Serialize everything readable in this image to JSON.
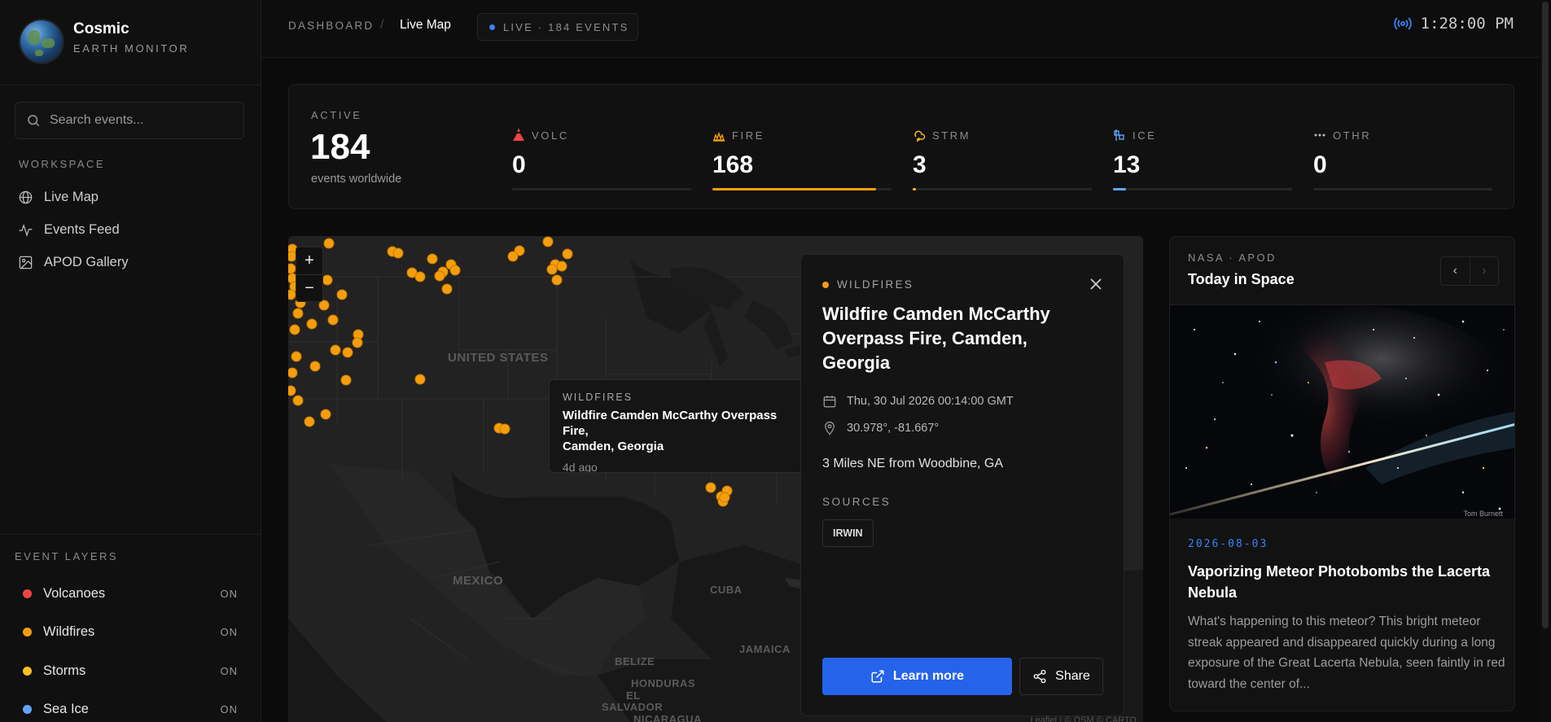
{
  "brand": {
    "name": "Cosmic",
    "subtitle": "EARTH MONITOR"
  },
  "search": {
    "placeholder": "Search events..."
  },
  "workspace": {
    "label": "WORKSPACE",
    "items": [
      {
        "label": "Live Map",
        "icon": "globe-icon"
      },
      {
        "label": "Events Feed",
        "icon": "activity-icon"
      },
      {
        "label": "APOD Gallery",
        "icon": "image-icon"
      }
    ]
  },
  "layers": {
    "label": "EVENT LAYERS",
    "items": [
      {
        "label": "Volcanoes",
        "status": "ON",
        "color": "#ef4444"
      },
      {
        "label": "Wildfires",
        "status": "ON",
        "color": "#f59e0b"
      },
      {
        "label": "Storms",
        "status": "ON",
        "color": "#fbbf24"
      },
      {
        "label": "Sea Ice",
        "status": "ON",
        "color": "#60a5fa"
      }
    ]
  },
  "header": {
    "breadcrumb_root": "DASHBOARD",
    "breadcrumb_current": "Live Map",
    "live_label": "LIVE · 184 EVENTS",
    "time": "1:28:00 PM"
  },
  "stats": {
    "active_label": "ACTIVE",
    "active_count": "184",
    "active_sub": "events worldwide",
    "items": [
      {
        "label": "VOLC",
        "value": "0",
        "fraction": 0,
        "color": "#ef4444",
        "icon": "volcano-icon"
      },
      {
        "label": "FIRE",
        "value": "168",
        "fraction": 0.913,
        "color": "#f59e0b",
        "icon": "fire-icon"
      },
      {
        "label": "STRM",
        "value": "3",
        "fraction": 0.016,
        "color": "#fbbf24",
        "icon": "storm-icon"
      },
      {
        "label": "ICE",
        "value": "13",
        "fraction": 0.071,
        "color": "#60a5fa",
        "icon": "ice-icon"
      },
      {
        "label": "OTHR",
        "value": "0",
        "fraction": 0,
        "color": "#9ca3af",
        "icon": "more-icon"
      }
    ]
  },
  "map": {
    "zoom_in": "+",
    "zoom_out": "−",
    "labels": {
      "usa": "UNITED STATES",
      "mexico": "MEXICO",
      "cuba": "CUBA",
      "jamaica": "JAMAICA",
      "belize": "BELIZE",
      "honduras": "HONDURAS",
      "el": "EL",
      "salvador": "SALVADOR",
      "nicaragua": "NICARAGUA"
    },
    "tooltip": {
      "category": "WILDFIRES",
      "title": "Wildfire Camden McCarthy Overpass Fire,\nCamden, Georgia",
      "age": "4d ago"
    },
    "attribution": "Leaflet | © OSM © CARTO"
  },
  "detail": {
    "category": "WILDFIRES",
    "title": "Wildfire Camden McCarthy Overpass Fire, Camden, Georgia",
    "date": "Thu, 30 Jul 2026 00:14:00 GMT",
    "coords": "30.978°, -81.667°",
    "location": "3 Miles NE from Woodbine, GA",
    "sources_label": "SOURCES",
    "source": "IRWIN",
    "learn_more": "Learn more",
    "share": "Share"
  },
  "apod": {
    "label": "NASA · APOD",
    "heading": "Today in Space",
    "image_credit": "Tom Burnett",
    "date": "2026-08-03",
    "title": "Vaporizing Meteor Photobombs the Lacerta Nebula",
    "description": "What's happening to this meteor? This bright meteor streak appeared and disappeared quickly during a long exposure of the Great Lacerta Nebula, seen faintly in red toward the center of..."
  }
}
